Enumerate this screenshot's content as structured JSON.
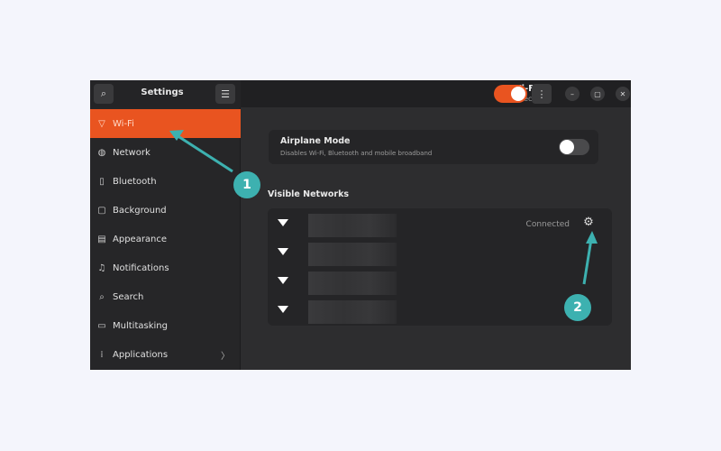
{
  "sidebar_header": {
    "title": "Settings"
  },
  "main_header": {
    "title": "Wi-Fi",
    "subtitle": "Connected",
    "wifi_enabled": true
  },
  "sidebar": {
    "items": [
      {
        "label": "Wi-Fi",
        "icon": "wifi-icon",
        "glyph": "▽",
        "active": true
      },
      {
        "label": "Network",
        "icon": "network-icon",
        "glyph": "◍"
      },
      {
        "label": "Bluetooth",
        "icon": "bluetooth-icon",
        "glyph": "▯"
      },
      {
        "label": "Background",
        "icon": "background-icon",
        "glyph": "▢"
      },
      {
        "label": "Appearance",
        "icon": "appearance-icon",
        "glyph": "▤"
      },
      {
        "label": "Notifications",
        "icon": "bell-icon",
        "glyph": "♫"
      },
      {
        "label": "Search",
        "icon": "search-icon",
        "glyph": "⌕"
      },
      {
        "label": "Multitasking",
        "icon": "multitasking-icon",
        "glyph": "▭"
      },
      {
        "label": "Applications",
        "icon": "grid-icon",
        "glyph": "⁞",
        "chevron": "〉"
      }
    ]
  },
  "airplane": {
    "title": "Airplane Mode",
    "subtitle": "Disables Wi-Fi, Bluetooth and mobile broadband",
    "enabled": false
  },
  "networks": {
    "title": "Visible Networks",
    "rows": [
      {
        "status": "Connected"
      },
      {
        "status": ""
      },
      {
        "status": ""
      },
      {
        "status": ""
      }
    ]
  },
  "annotations": {
    "badge1": "1",
    "badge2": "2",
    "color": "#3db1b0"
  },
  "icons": {
    "search": "⌕",
    "menu": "☰",
    "more": "⋮",
    "minimize": "–",
    "maximize": "▢",
    "close": "✕",
    "gear": "⚙"
  }
}
